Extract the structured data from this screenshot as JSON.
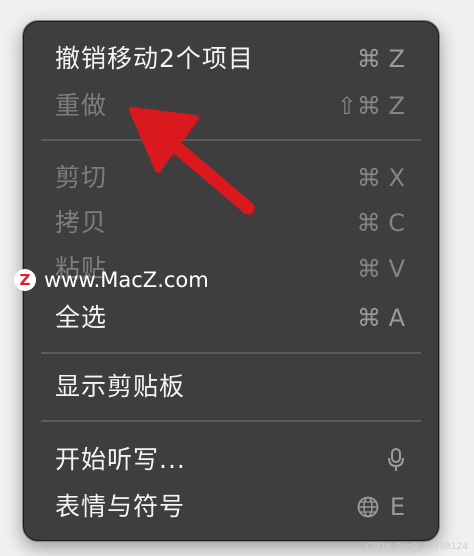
{
  "menu": {
    "items": [
      {
        "label": "撤销移动2个项目",
        "shortcut": "⌘ Z",
        "enabled": true
      },
      {
        "label": "重做",
        "shortcut": "⇧⌘ Z",
        "enabled": false
      },
      {
        "label": "剪切",
        "shortcut": "⌘ X",
        "enabled": false
      },
      {
        "label": "拷贝",
        "shortcut": "⌘ C",
        "enabled": false
      },
      {
        "label": "粘贴",
        "shortcut": "⌘ V",
        "enabled": false
      },
      {
        "label": "全选",
        "shortcut": "⌘ A",
        "enabled": true
      },
      {
        "label": "显示剪贴板",
        "shortcut": "",
        "enabled": true
      },
      {
        "label": "开始听写...",
        "shortcut_icon": "microphone-icon",
        "enabled": true
      },
      {
        "label": "表情与符号",
        "shortcut_icon": "globe-icon",
        "shortcut": "E",
        "enabled": true
      }
    ]
  },
  "watermark": {
    "logo_letter": "Z",
    "text": "www.MacZ.com"
  },
  "csdn_watermark": "CSDN @m0_72498124",
  "colors": {
    "menu_bg": "#3e3e3e",
    "annotation_arrow": "#e8141e"
  }
}
